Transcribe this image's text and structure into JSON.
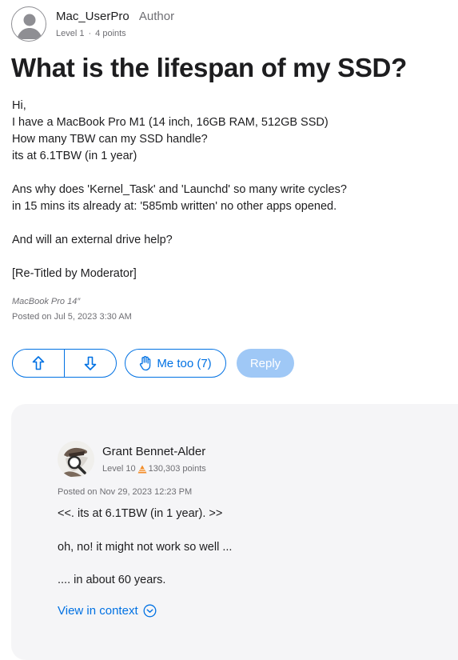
{
  "question": {
    "author": {
      "name": "Mac_UserPro",
      "badge": "Author",
      "level": "Level 1",
      "separator": "·",
      "points": "4 points",
      "avatar_icon": "default-user-icon"
    },
    "title": "What is the lifespan of my SSD?",
    "body_paragraphs": [
      [
        "Hi,",
        "I have a MacBook Pro M1 (14 inch, 16GB RAM, 512GB SSD)",
        "How many TBW can my SSD handle?",
        "its at 6.1TBW (in 1 year)"
      ],
      [
        "Ans why does 'Kernel_Task' and 'Launchd' so many write cycles?",
        "in 15 mins its already at: '585mb written' no other apps opened."
      ],
      [
        "And will an external drive help?"
      ],
      [
        "[Re-Titled by Moderator]"
      ]
    ],
    "device": "MacBook Pro 14″",
    "posted": "Posted on Jul 5, 2023 3:30 AM"
  },
  "actions": {
    "upvote_icon": "arrow-up-icon",
    "downvote_icon": "arrow-down-icon",
    "me_too_icon": "hand-icon",
    "me_too_label": "Me too (7)",
    "reply_label": "Reply",
    "accent_color": "#0071e3",
    "reply_disabled_color": "#9fc8f6"
  },
  "answer": {
    "author": {
      "name": "Grant Bennet-Alder",
      "level": "Level 10",
      "level_icon": "level-pyramid-icon",
      "points": "130,303 points",
      "avatar_icon": "detective-magnifier-icon"
    },
    "posted": "Posted on Nov 29, 2023 12:23 PM",
    "paragraphs": [
      "<<. its at 6.1TBW (in 1 year). >>",
      "oh, no! it might not work so well ...",
      ".... in about 60 years."
    ],
    "view_in_context": "View in context",
    "view_in_context_icon": "chevron-down-circle-icon"
  }
}
